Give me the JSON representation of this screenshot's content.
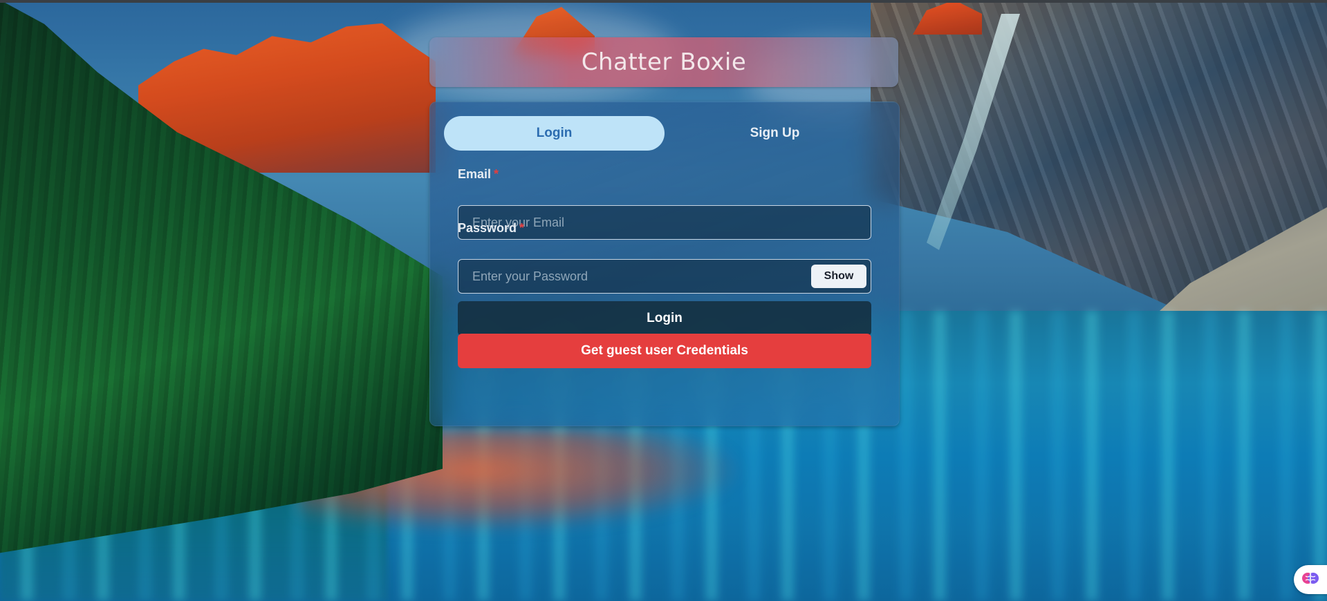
{
  "app": {
    "title": "Chatter Boxie"
  },
  "tabs": [
    {
      "label": "Login",
      "active": true
    },
    {
      "label": "Sign Up",
      "active": false
    }
  ],
  "form": {
    "email": {
      "label": "Email",
      "required_mark": "*",
      "placeholder": "Enter your Email",
      "value": ""
    },
    "password": {
      "label": "Password",
      "required_mark": "*",
      "placeholder": "Enter your Password",
      "value": "",
      "toggle_label": "Show"
    },
    "login_button": "Login",
    "guest_button": "Get guest user Credentials"
  },
  "widget": {
    "icon": "brain-icon"
  },
  "colors": {
    "tab_active_bg": "#bee3f8",
    "tab_active_text": "#2b6cb0",
    "guest_button": "#e53e3e",
    "required": "#e53e3e"
  }
}
